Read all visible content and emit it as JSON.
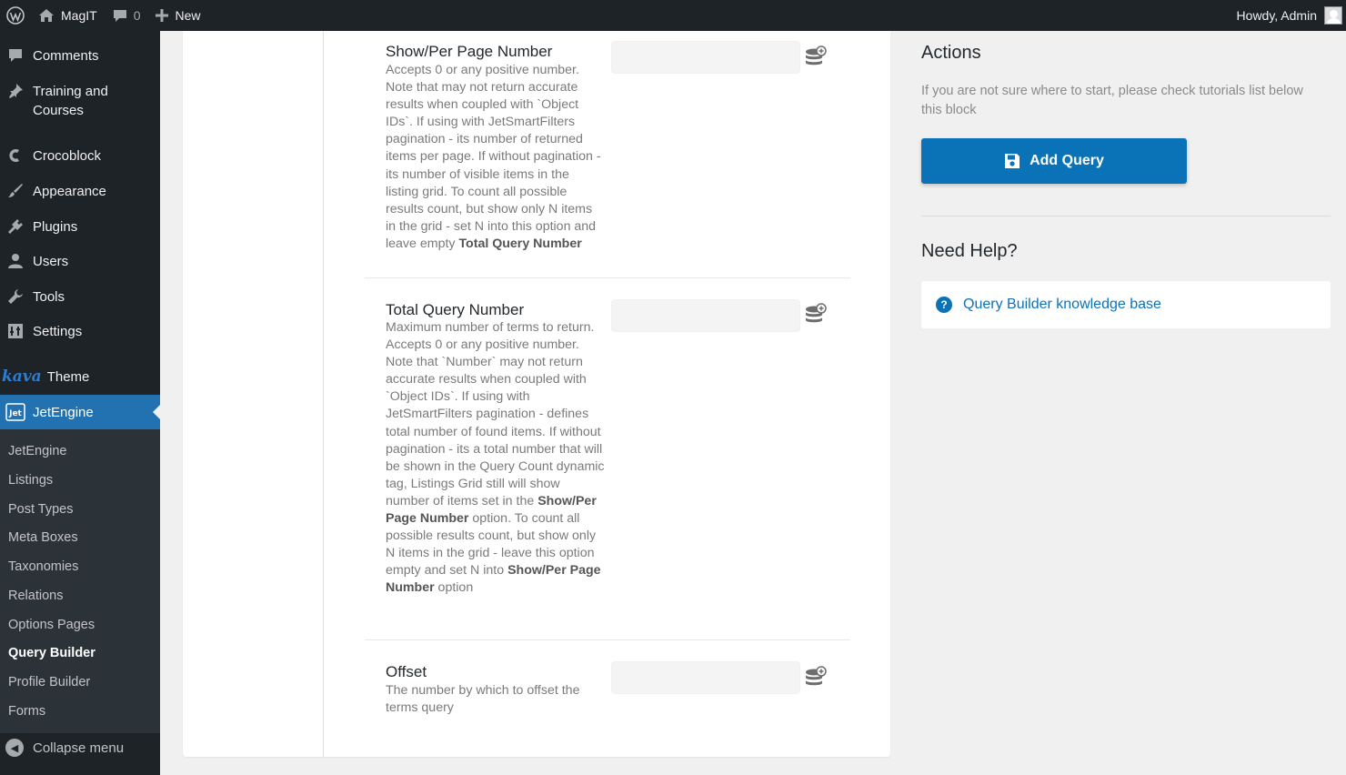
{
  "adminbar": {
    "site_name": "MagIT",
    "comments_count": "0",
    "new_label": "New",
    "greeting": "Howdy, Admin"
  },
  "sidebar": {
    "items": [
      {
        "label": "Comments",
        "icon": "comment-icon"
      },
      {
        "label": "Training and Courses",
        "icon": "pin-icon"
      },
      {
        "label": "Crocoblock",
        "icon": "crocoblock-icon"
      },
      {
        "label": "Appearance",
        "icon": "brush-icon"
      },
      {
        "label": "Plugins",
        "icon": "plugin-icon"
      },
      {
        "label": "Users",
        "icon": "user-icon"
      },
      {
        "label": "Tools",
        "icon": "wrench-icon"
      },
      {
        "label": "Settings",
        "icon": "settings-icon"
      },
      {
        "label": "Theme",
        "logo": "kava"
      },
      {
        "label": "JetEngine",
        "icon": "jetengine-icon",
        "active": true
      }
    ],
    "submenu": [
      "JetEngine",
      "Listings",
      "Post Types",
      "Meta Boxes",
      "Taxonomies",
      "Relations",
      "Options Pages",
      "Query Builder",
      "Profile Builder",
      "Forms"
    ],
    "current_submenu": "Query Builder",
    "collapse_label": "Collapse menu"
  },
  "fields": {
    "per_page": {
      "title": "Show/Per Page Number",
      "desc_1": "Accepts 0 or any positive number. Note that may not return accurate results when coupled with `Object IDs`. If using with JetSmartFilters pagination - its number of returned items per page. If without pagination - its number of visible items in the listing grid. To count all possible results count, but show only N items in the grid - set N into this option and leave empty ",
      "desc_bold": "Total Query Number",
      "value": ""
    },
    "total": {
      "title": "Total Query Number",
      "desc_1": "Maximum number of terms to return. Accepts 0 or any positive number. Note that `Number` may not return accurate results when coupled with `Object IDs`. If using with JetSmartFilters pagination - defines total number of found items. If without pagination - its a total number that will be shown in the Query Count dynamic tag, Listings Grid still will show number of items set in the ",
      "desc_bold_1": "Show/Per Page Number",
      "desc_2": " option. To count all possible results count, but show only N items in the grid - leave this option empty and set N into ",
      "desc_bold_2": "Show/Per Page Number",
      "desc_3": " option",
      "value": ""
    },
    "offset": {
      "title": "Offset",
      "desc": "The number by which to offset the terms query",
      "value": ""
    }
  },
  "actions": {
    "title": "Actions",
    "note": "If you are not sure where to start, please check tutorials list below this block",
    "add_button": "Add Query"
  },
  "help": {
    "title": "Need Help?",
    "link": "Query Builder knowledge base"
  },
  "colors": {
    "accent": "#2271b1",
    "button": "#0a73b8",
    "sidebar_bg": "#1d2327"
  }
}
